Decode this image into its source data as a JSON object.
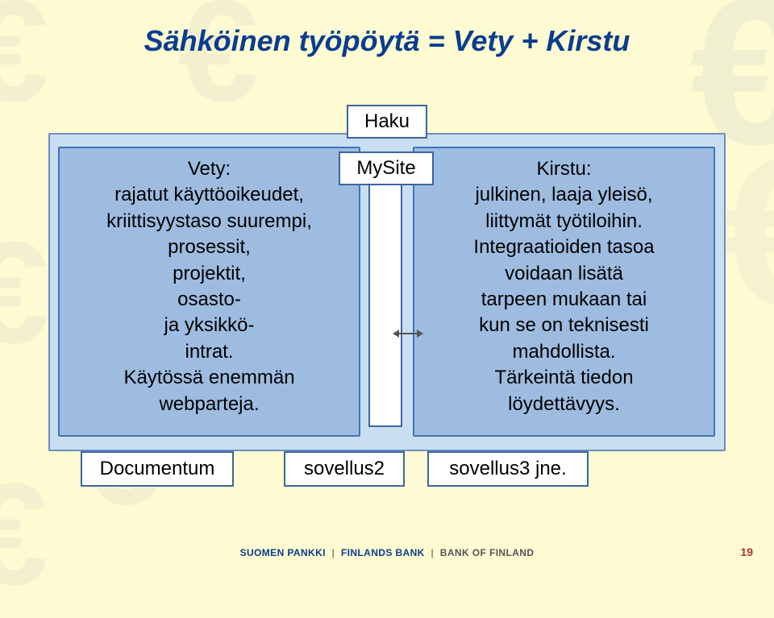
{
  "title": "Sähköinen työpöytä = Vety + Kirstu",
  "diagram": {
    "haku": "Haku",
    "mysite": "MySite",
    "left_text": "Vety:\nrajatut käyttöoikeudet,\nkriittisyystaso suurempi,\nprosessit,\nprojektit,\nosasto-\nja yksikkö-\nintrat.\nKäytössä enemmän\nwebparteja.",
    "right_text": "Kirstu:\njulkinen, laaja yleisö,\nliittymät työtiloihin.\nIntegraatioiden tasoa\nvoidaan lisätä\ntarpeen mukaan tai\nkun se on teknisesti\nmahdollista.\nTärkeintä tiedon\nlöydettävyys.",
    "tags": {
      "documentum": "Documentum",
      "sovellus2": "sovellus2",
      "sovellus3": "sovellus3 jne."
    }
  },
  "footer": {
    "part1": "SUOMEN PANKKI",
    "part2": "FINLANDS BANK",
    "part3": "BANK OF FINLAND"
  },
  "page_number": "19"
}
